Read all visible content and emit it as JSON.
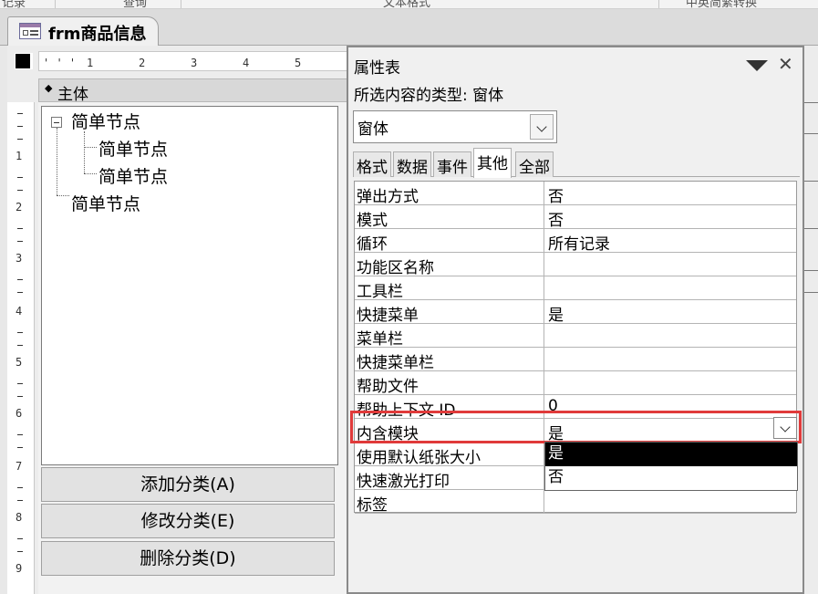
{
  "top_strip": {
    "items": [
      "记录",
      "查询",
      "文本格式",
      "中英简繁转换"
    ]
  },
  "document_tab": {
    "title": "frm商品信息",
    "icon": "form-icon"
  },
  "design": {
    "ruler_ticks": [
      "1",
      "2",
      "3",
      "4",
      "5"
    ],
    "vertical_ruler_ticks": [
      "1",
      "2",
      "3",
      "4",
      "5",
      "6",
      "7",
      "8",
      "9"
    ],
    "section_label": "主体",
    "tree_nodes": [
      "简单节点",
      "简单节点",
      "简单节点",
      "简单节点"
    ],
    "buttons": [
      "添加分类(A)",
      "修改分类(E)",
      "删除分类(D)"
    ]
  },
  "property_sheet": {
    "title": "属性表",
    "selection_type": "所选内容的类型: 窗体",
    "object_select": "窗体",
    "tabs": [
      "格式",
      "数据",
      "事件",
      "其他",
      "全部"
    ],
    "active_tab": "其他",
    "rows": [
      {
        "name": "弹出方式",
        "value": "否"
      },
      {
        "name": "模式",
        "value": "否"
      },
      {
        "name": "循环",
        "value": "所有记录"
      },
      {
        "name": "功能区名称",
        "value": ""
      },
      {
        "name": "工具栏",
        "value": ""
      },
      {
        "name": "快捷菜单",
        "value": "是"
      },
      {
        "name": "菜单栏",
        "value": ""
      },
      {
        "name": "快捷菜单栏",
        "value": ""
      },
      {
        "name": "帮助文件",
        "value": ""
      },
      {
        "name": "帮助上下文 ID",
        "value": "0"
      },
      {
        "name": "内含模块",
        "value": "是"
      },
      {
        "name": "使用默认纸张大小",
        "value": ""
      },
      {
        "name": "快速激光打印",
        "value": ""
      },
      {
        "name": "标签",
        "value": ""
      }
    ],
    "dropdown_options": [
      "是",
      "否"
    ],
    "highlight_color": "#e03a3a"
  }
}
